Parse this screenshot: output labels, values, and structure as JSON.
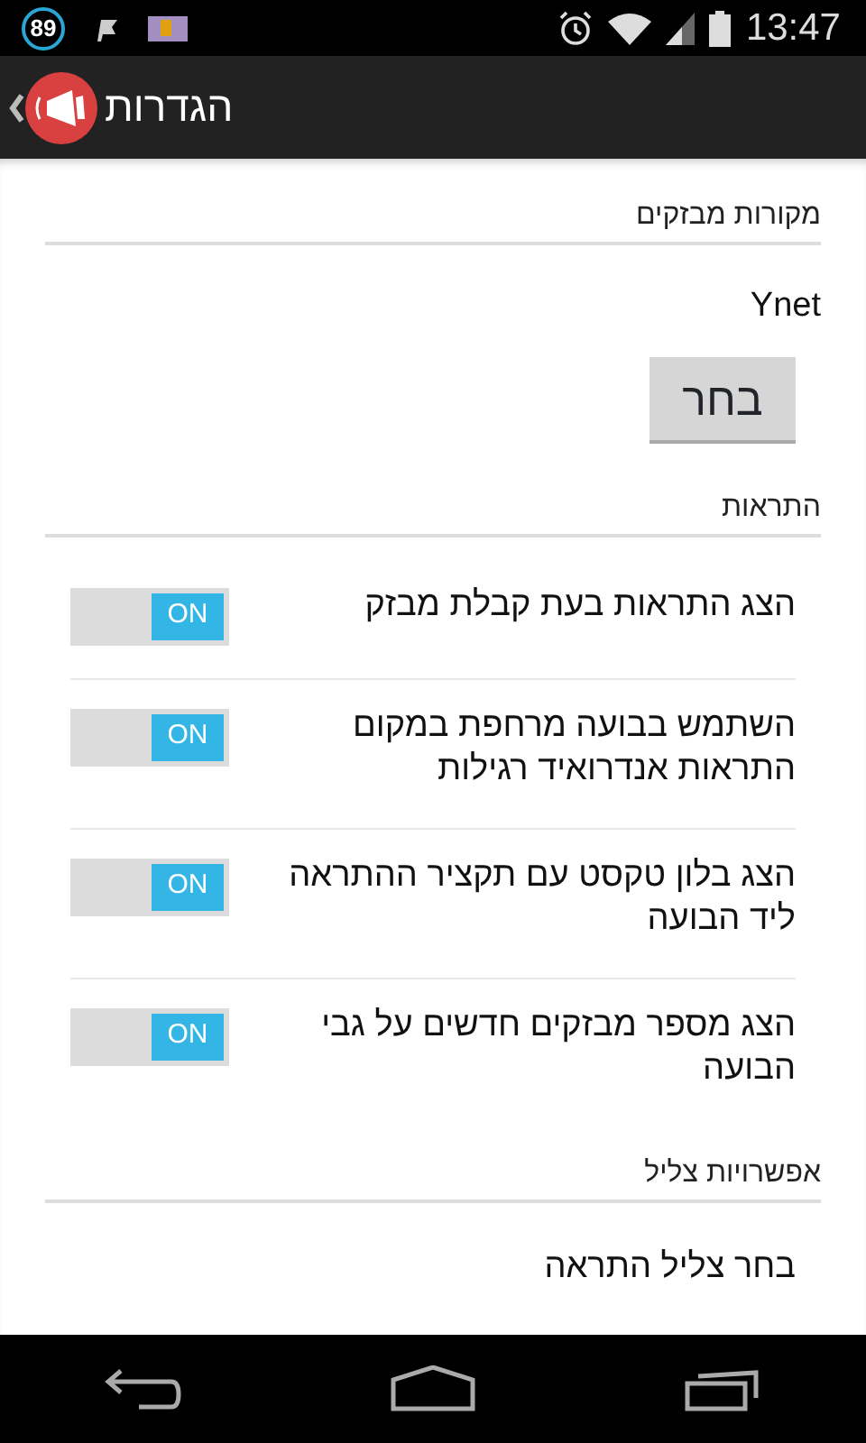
{
  "status_bar": {
    "notification_count": "89",
    "time": "13:47"
  },
  "action_bar": {
    "title": "הגדרות"
  },
  "sections": [
    {
      "header": "מקורות מבזקים",
      "items": [
        {
          "kind": "value",
          "text": "Ynet"
        },
        {
          "kind": "button",
          "label": "בחר"
        }
      ]
    },
    {
      "header": "התראות",
      "items": [
        {
          "kind": "toggle",
          "text": "הצג התראות בעת קבלת מבזק",
          "on": true,
          "state_label": "ON"
        },
        {
          "kind": "toggle",
          "text": "השתמש בבועה מרחפת במקום התראות אנדרואיד רגילות",
          "on": true,
          "state_label": "ON"
        },
        {
          "kind": "toggle",
          "text": "הצג בלון טקסט עם תקציר ההתראה ליד הבועה",
          "on": true,
          "state_label": "ON"
        },
        {
          "kind": "toggle",
          "text": "הצג מספר מבזקים חדשים על גבי הבועה",
          "on": true,
          "state_label": "ON"
        }
      ]
    },
    {
      "header": "אפשרויות צליל",
      "items": [
        {
          "kind": "link",
          "text": "בחר צליל התראה"
        }
      ]
    }
  ]
}
